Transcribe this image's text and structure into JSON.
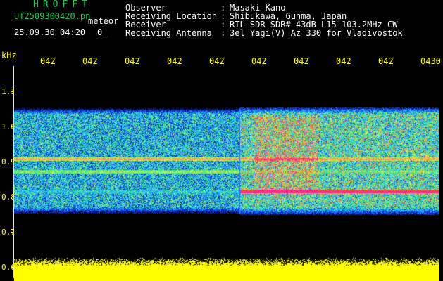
{
  "header": {
    "app_title": "HROFFT",
    "file_name": "UT2509300420.pn",
    "file_suffix": "meteor",
    "date_time": "25.09.30 04:20",
    "date_extra": "0_"
  },
  "station_info": [
    {
      "label": "Observer",
      "value": "Masaki Kano"
    },
    {
      "label": "Receiving Location",
      "value": "Shibukawa, Gunma, Japan"
    },
    {
      "label": "Receiver",
      "value": "RTL-SDR SDR# 43dB L15 103.2MHz CW"
    },
    {
      "label": "Receiving Antenna",
      "value": "3el Yagi(V) Az 330 for Vladivostok"
    }
  ],
  "colon": ":",
  "axis": {
    "ylabel": "kHz",
    "x_ticks": [
      "042",
      "042",
      "042",
      "042",
      "042",
      "042",
      "042",
      "042",
      "042",
      "0430"
    ],
    "y_ticks": [
      "1.1",
      "1.0",
      "0.9",
      "0.8",
      "0.7",
      "0.6"
    ]
  },
  "colors": {
    "text": "#ffffff",
    "accent_green": "#22c55e",
    "axis_yellow": "#ffff00",
    "background": "#000000",
    "signal_pink": "#ff2a8a"
  },
  "spectrogram": {
    "event_start_fraction": 0.53,
    "signal_lines_khz": [
      0.908,
      0.872,
      0.815
    ]
  }
}
